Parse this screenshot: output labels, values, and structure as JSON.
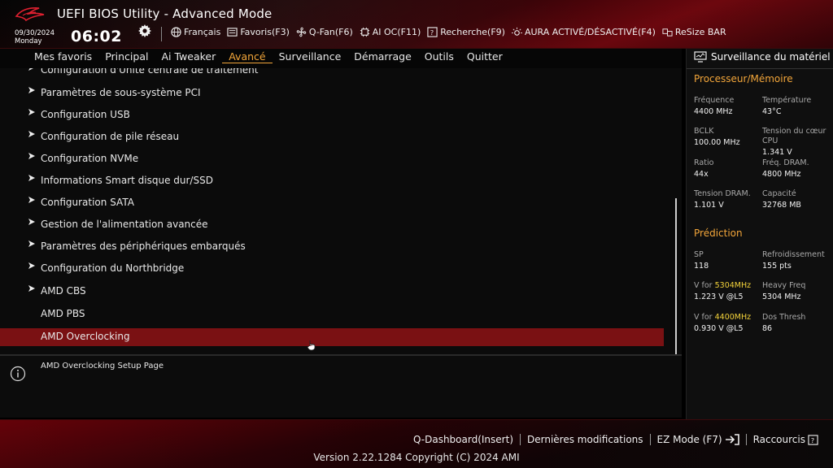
{
  "header": {
    "title": "UEFI BIOS Utility - Advanced Mode",
    "date": "09/30/2024",
    "day": "Monday",
    "time": "06:02",
    "toolbar": [
      {
        "label": "Français",
        "icon": "globe-icon"
      },
      {
        "label": "Favoris(F3)",
        "icon": "favorites-icon"
      },
      {
        "label": "Q-Fan(F6)",
        "icon": "fan-icon"
      },
      {
        "label": "AI OC(F11)",
        "icon": "ai-chip-icon"
      },
      {
        "label": "Recherche(F9)",
        "icon": "search-help-icon"
      },
      {
        "label": "AURA ACTIVÉ/DÉSACTIVÉ(F4)",
        "icon": "aura-light-icon"
      },
      {
        "label": "ReSize BAR",
        "icon": "resize-bar-icon"
      }
    ]
  },
  "nav": {
    "tabs": [
      "Mes favoris",
      "Principal",
      "Ai Tweaker",
      "Avancé",
      "Surveillance",
      "Démarrage",
      "Outils",
      "Quitter"
    ],
    "active": "Avancé"
  },
  "menu": {
    "items": [
      {
        "label": "Configuration d'Unité centrale de traitement",
        "arrow": true
      },
      {
        "label": "Paramètres de sous-système PCI",
        "arrow": true
      },
      {
        "label": "Configuration USB",
        "arrow": true
      },
      {
        "label": "Configuration de pile réseau",
        "arrow": true
      },
      {
        "label": "Configuration NVMe",
        "arrow": true
      },
      {
        "label": "Informations Smart disque dur/SSD",
        "arrow": true
      },
      {
        "label": "Configuration SATA",
        "arrow": true
      },
      {
        "label": "Gestion de l'alimentation avancée",
        "arrow": true
      },
      {
        "label": "Paramètres des périphériques embarqués",
        "arrow": true
      },
      {
        "label": "Configuration du Northbridge",
        "arrow": true
      },
      {
        "label": "AMD CBS",
        "arrow": true
      },
      {
        "label": "AMD PBS",
        "arrow": false
      },
      {
        "label": "AMD Overclocking",
        "arrow": false,
        "selected": true
      }
    ]
  },
  "help": {
    "text": "AMD Overclocking Setup Page"
  },
  "hw_monitor": {
    "title": "Surveillance du matériel",
    "cpu_mem": {
      "heading": "Processeur/Mémoire",
      "frequency_label": "Fréquence",
      "frequency": "4400 MHz",
      "temperature_label": "Température",
      "temperature": "43°C",
      "bclk_label": "BCLK",
      "bclk": "100.00 MHz",
      "core_voltage_label": "Tension du cœur CPU",
      "core_voltage": "1.341 V",
      "ratio_label": "Ratio",
      "ratio": "44x",
      "dram_freq_label": "Fréq. DRAM.",
      "dram_freq": "4800 MHz",
      "dram_voltage_label": "Tension DRAM.",
      "dram_voltage": "1.101 V",
      "capacity_label": "Capacité",
      "capacity": "32768 MB"
    },
    "prediction": {
      "heading": "Prédiction",
      "sp_label": "SP",
      "sp": "118",
      "cooling_label": "Refroidissement",
      "cooling": "155 pts",
      "vfor1_prefix": "V for ",
      "vfor1_freq": "5304MHz",
      "vfor1_value": "1.223 V @L5",
      "heavy_freq_label": "Heavy Freq",
      "heavy_freq": "5304 MHz",
      "vfor2_prefix": "V for ",
      "vfor2_freq": "4400MHz",
      "vfor2_value": "0.930 V @L5",
      "dos_thresh_label": "Dos Thresh",
      "dos_thresh": "86"
    }
  },
  "footer": {
    "links": [
      "Q-Dashboard(Insert)",
      "Dernières modifications",
      "EZ Mode (F7)",
      "Raccourcis"
    ],
    "version": "Version 2.22.1284 Copyright (C) 2024 AMI"
  },
  "colors": {
    "accent": "#f3a63a",
    "highlight_freq": "#f3d23a",
    "selected_row": "#7a1113",
    "brand_red": "#c0101a"
  }
}
